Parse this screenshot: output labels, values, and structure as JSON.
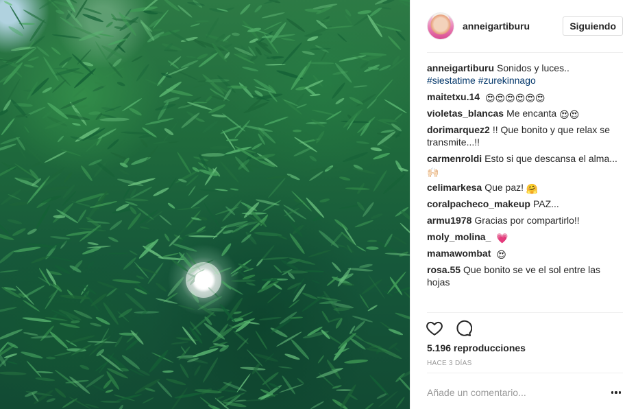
{
  "post": {
    "username": "anneigartiburu",
    "follow_label": "Siguiendo",
    "caption_user": "anneigartiburu",
    "caption_text": "Sonidos y luces..",
    "hashtags": [
      "#siestatime",
      "#zurekinnago"
    ]
  },
  "comments": [
    {
      "user": "maitetxu.14",
      "text": "",
      "emoji": "😍😍😍😍😍😍"
    },
    {
      "user": "violetas_blancas",
      "text": "Me encanta",
      "emoji": "😍😍"
    },
    {
      "user": "dorimarquez2",
      "text": "!! Que bonito y que relax se transmite...!!",
      "emoji": ""
    },
    {
      "user": "carmenroldi",
      "text": "Esto si que descansa el alma...",
      "emoji": "🙌🏻"
    },
    {
      "user": "celimarkesa",
      "text": "Que paz!",
      "emoji": "🤗"
    },
    {
      "user": "coralpacheco_makeup",
      "text": "PAZ...",
      "emoji": ""
    },
    {
      "user": "armu1978",
      "text": "Gracias por compartirlo!!",
      "emoji": ""
    },
    {
      "user": "moly_molina_",
      "text": "",
      "emoji": "💗"
    },
    {
      "user": "mamawombat",
      "text": "",
      "emoji": "😍"
    },
    {
      "user": "rosa.55",
      "text": "Que bonito se ve el sol entre las hojas",
      "emoji": ""
    }
  ],
  "stats": {
    "views": "5.196 reproducciones",
    "time_ago": "HACE 3 DÍAS"
  },
  "composer": {
    "placeholder": "Añade un comentario..."
  },
  "icons": {
    "like": "heart-icon",
    "comment": "comment-icon",
    "more": "more-options-icon"
  },
  "colors": {
    "hashtag": "#003569",
    "muted": "#999999",
    "text": "#262626"
  }
}
